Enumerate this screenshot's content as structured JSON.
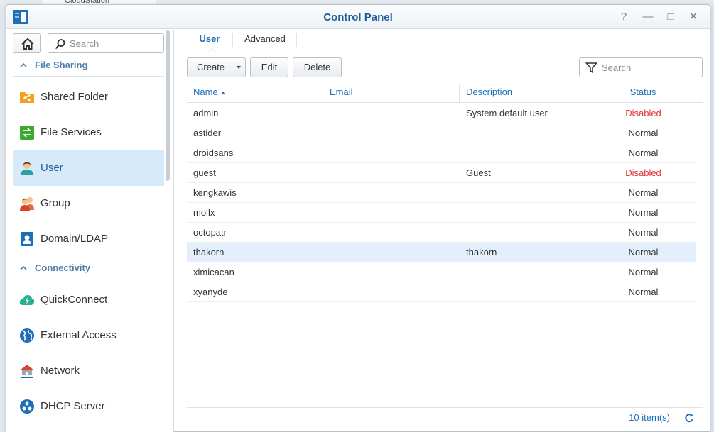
{
  "background": {
    "ghost_window_label": "CloudStation"
  },
  "window": {
    "title": "Control Panel",
    "controls": {
      "help": "?",
      "minimize": "—",
      "maximize": "□",
      "close": "✕"
    }
  },
  "sidebar": {
    "search_placeholder": "Search",
    "sections": [
      {
        "title": "File Sharing",
        "items": [
          {
            "label": "Shared Folder",
            "icon": "shared-folder-icon"
          },
          {
            "label": "File Services",
            "icon": "file-services-icon"
          },
          {
            "label": "User",
            "icon": "user-icon",
            "active": true
          },
          {
            "label": "Group",
            "icon": "group-icon"
          },
          {
            "label": "Domain/LDAP",
            "icon": "domain-ldap-icon"
          }
        ]
      },
      {
        "title": "Connectivity",
        "items": [
          {
            "label": "QuickConnect",
            "icon": "quickconnect-icon"
          },
          {
            "label": "External Access",
            "icon": "external-access-icon"
          },
          {
            "label": "Network",
            "icon": "network-icon"
          },
          {
            "label": "DHCP Server",
            "icon": "dhcp-server-icon"
          }
        ]
      }
    ]
  },
  "tabs": [
    {
      "label": "User",
      "active": true
    },
    {
      "label": "Advanced"
    }
  ],
  "toolbar": {
    "create": "Create",
    "edit": "Edit",
    "delete": "Delete",
    "search_placeholder": "Search"
  },
  "table": {
    "columns": [
      "Name",
      "Email",
      "Description",
      "Status"
    ],
    "sort_column": "Name",
    "rows": [
      {
        "name": "admin",
        "email": "",
        "description": "System default user",
        "status": "Disabled"
      },
      {
        "name": "astider",
        "email": "",
        "description": "",
        "status": "Normal"
      },
      {
        "name": "droidsans",
        "email": "",
        "description": "",
        "status": "Normal"
      },
      {
        "name": "guest",
        "email": "",
        "description": "Guest",
        "status": "Disabled"
      },
      {
        "name": "kengkawis",
        "email": "",
        "description": "",
        "status": "Normal"
      },
      {
        "name": "mollx",
        "email": "",
        "description": "",
        "status": "Normal"
      },
      {
        "name": "octopatr",
        "email": "",
        "description": "",
        "status": "Normal"
      },
      {
        "name": "thakorn",
        "email": "",
        "description": "thakorn",
        "status": "Normal",
        "selected": true
      },
      {
        "name": "ximicacan",
        "email": "",
        "description": "",
        "status": "Normal"
      },
      {
        "name": "xyanyde",
        "email": "",
        "description": "",
        "status": "Normal"
      }
    ]
  },
  "footer": {
    "item_count": "10 item(s)"
  },
  "colors": {
    "accent": "#1f6fb8",
    "selected_row": "#e3f0fc",
    "active_nav": "#d6eafa",
    "disabled_status": "#e0343a"
  }
}
